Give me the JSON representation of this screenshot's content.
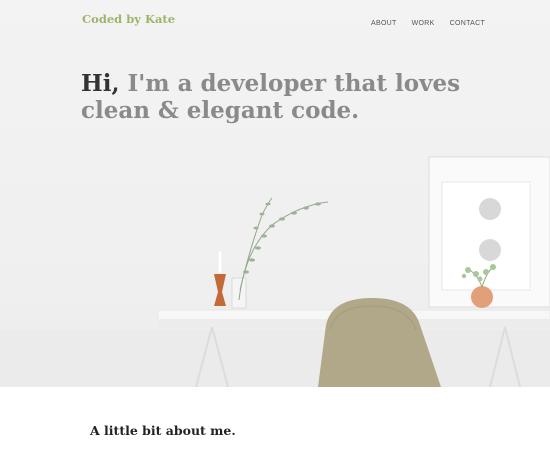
{
  "brand": {
    "name": "Coded by Kate",
    "color": "#9fb46a"
  },
  "nav": {
    "items": [
      "ABOUT",
      "WORK",
      "CONTACT"
    ]
  },
  "hero": {
    "greeting": "Hi,",
    "headline_rest": " I'm a developer that loves clean & elegant code.",
    "image": "white desk with beige chair, plant vase, candle, framed print"
  },
  "about": {
    "title": "A little bit about me."
  }
}
